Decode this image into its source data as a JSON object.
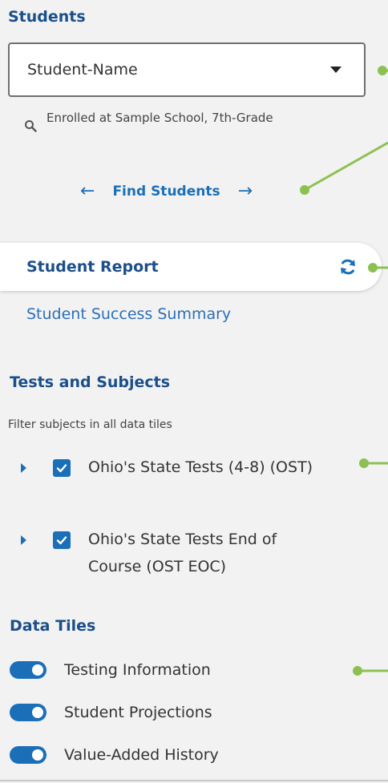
{
  "students": {
    "title": "Students",
    "selected_student": "Student-Name",
    "enrolled_text": "Enrolled at Sample School, 7th-Grade",
    "find_label": "Find Students"
  },
  "reports": {
    "active_label": "Student Report",
    "other_label": "Student Success Summary"
  },
  "tests": {
    "title": "Tests and Subjects",
    "filter_note": "Filter subjects in all data tiles",
    "items": [
      {
        "label": "Ohio's State Tests (4-8) (OST)",
        "checked": true
      },
      {
        "label": "Ohio's State Tests End of Course (OST EOC)",
        "checked": true
      }
    ]
  },
  "tiles": {
    "title": "Data Tiles",
    "items": [
      {
        "label": "Testing Information",
        "on": true
      },
      {
        "label": "Student Projections",
        "on": true
      },
      {
        "label": "Value-Added History",
        "on": true
      }
    ]
  },
  "colors": {
    "accent": "#1b6fb8",
    "heading": "#1b4f8a",
    "callout": "#8cc152",
    "background": "#f2f2f2"
  }
}
